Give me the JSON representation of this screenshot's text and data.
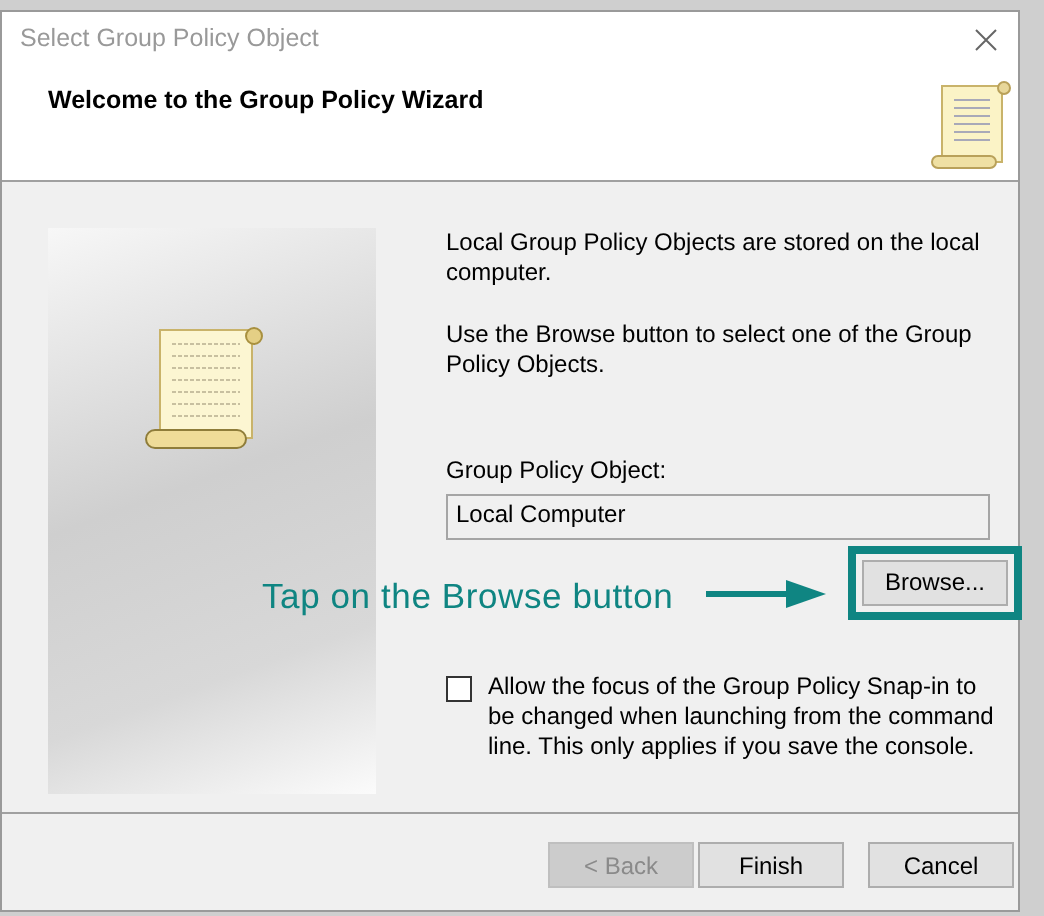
{
  "window": {
    "title": "Select Group Policy Object"
  },
  "header": {
    "title": "Welcome to the Group Policy Wizard"
  },
  "intro": [
    "Local Group Policy Objects are stored on the local computer.",
    "Use the Browse button to select one of the Group Policy Objects."
  ],
  "gpo_field": {
    "label": "Group Policy Object:",
    "value": "Local Computer"
  },
  "browse_button": {
    "label": "Browse...",
    "highlighted": true
  },
  "annotation": {
    "text": "Tap on the Browse button"
  },
  "focus_option": {
    "label": "Allow the focus of the Group Policy Snap-in to be changed when launching from the command line.  This only applies if you save the console.",
    "checked": false
  },
  "buttons": [
    {
      "label": "< Back",
      "disabled": true
    },
    {
      "label": "Finish",
      "disabled": false
    },
    {
      "label": "Cancel",
      "disabled": false
    }
  ]
}
